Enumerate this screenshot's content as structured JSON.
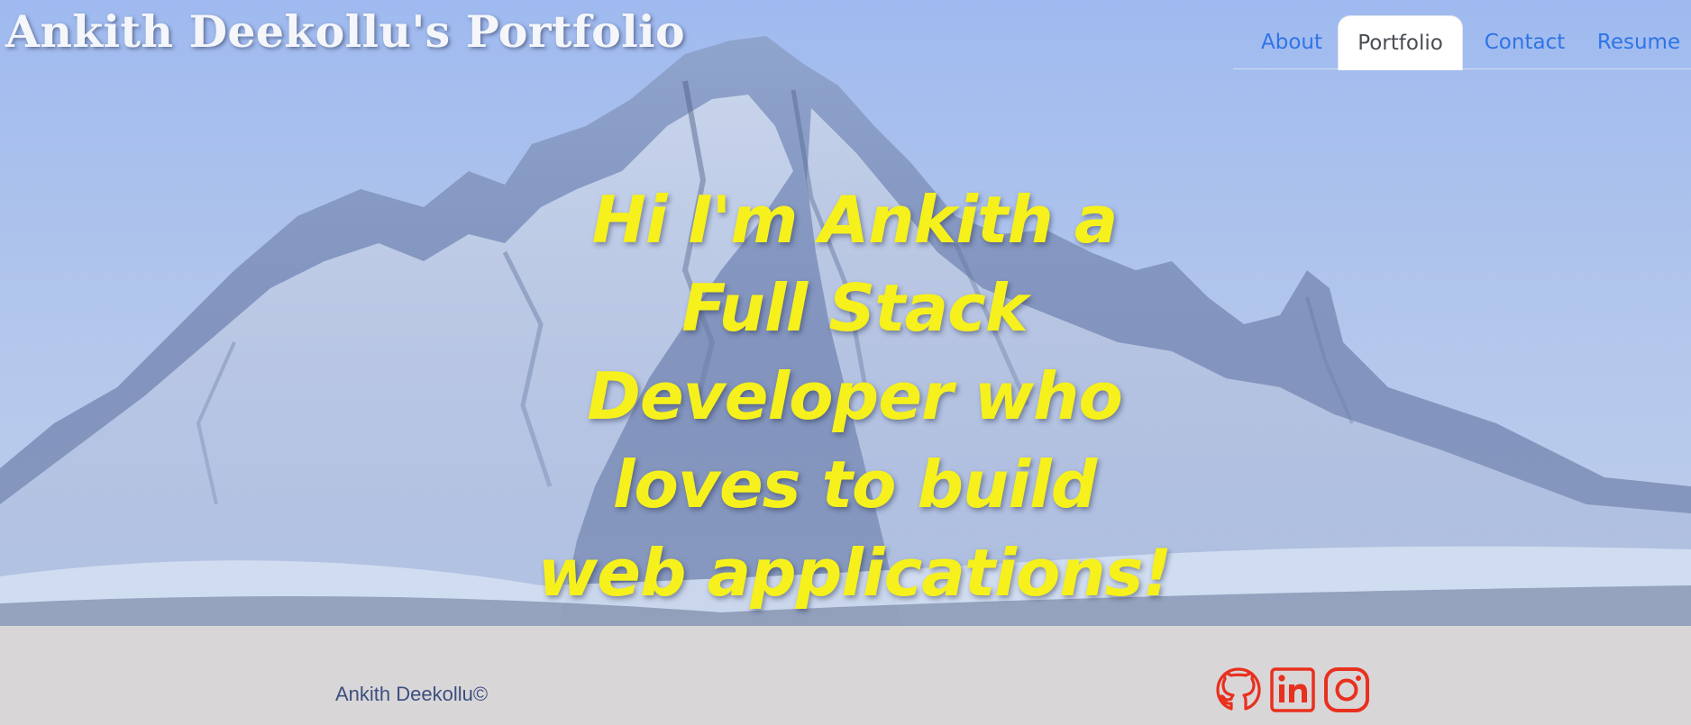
{
  "header": {
    "site_title": "Ankith Deekollu's Portfolio"
  },
  "nav": {
    "items": [
      {
        "label": "About",
        "active": false
      },
      {
        "label": "Portfolio",
        "active": true
      },
      {
        "label": "Contact",
        "active": false
      },
      {
        "label": "Resume",
        "active": false
      }
    ]
  },
  "hero": {
    "headline_lines": [
      "Hi I'm Ankith a",
      "Full Stack",
      "Developer who",
      "loves to build",
      "web applications!"
    ],
    "headline_color": "#f6f11c",
    "background": "snowy-mountain-photo"
  },
  "footer": {
    "copyright": "Ankith Deekollu©",
    "social_icons": [
      "github-icon",
      "linkedin-icon",
      "instagram-icon"
    ],
    "icon_color": "#e8301e"
  },
  "colors": {
    "nav_link": "#2f74e6",
    "nav_active_text": "#4a4d55",
    "footer_bg": "#d9d6d8",
    "copyright_text": "#3b4f7e"
  }
}
